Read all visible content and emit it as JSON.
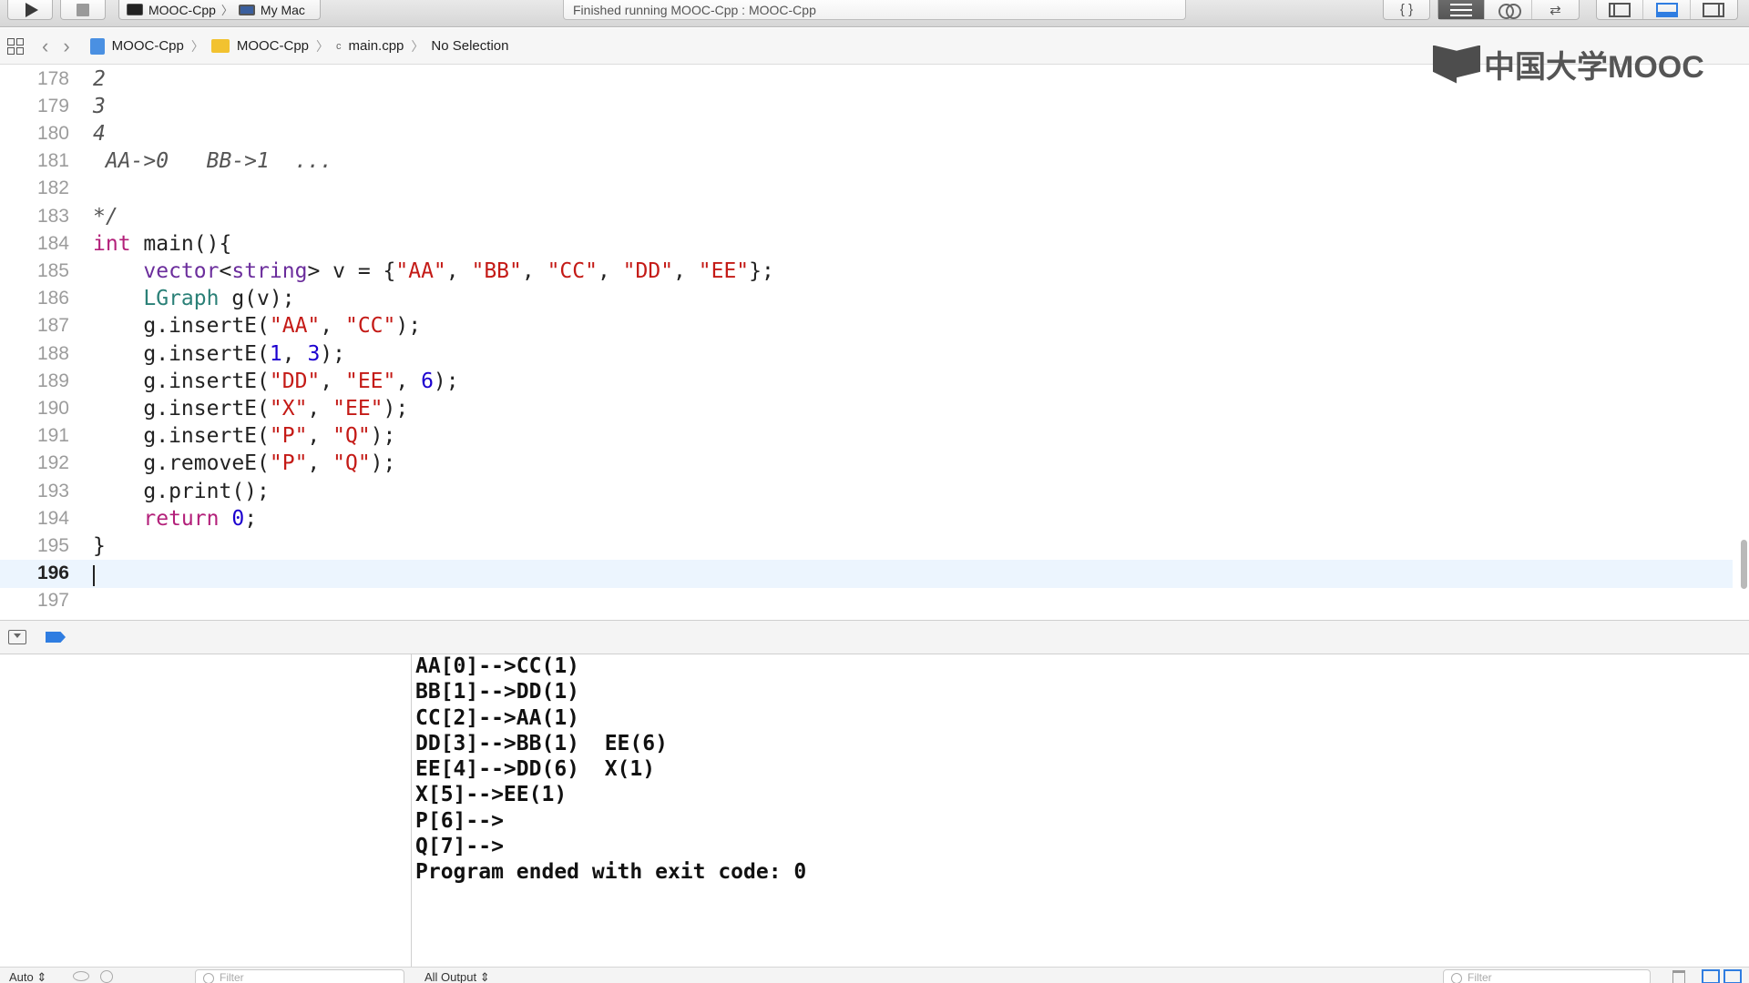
{
  "toolbar": {
    "scheme_name": "MOOC-Cpp",
    "destination": "My Mac",
    "activity_status": "Finished running MOOC-Cpp : MOOC-Cpp",
    "braces_label": "{ }",
    "swap_label": "⇄"
  },
  "jumpbar": {
    "project": "MOOC-Cpp",
    "folder": "MOOC-Cpp",
    "file_icon_text": "c",
    "file": "main.cpp",
    "selection": "No Selection"
  },
  "watermark": {
    "text": "中国大学MOOC"
  },
  "editor": {
    "lines": [
      {
        "num": "178",
        "tokens": [
          {
            "t": "2",
            "c": "comment"
          }
        ]
      },
      {
        "num": "179",
        "tokens": [
          {
            "t": "3",
            "c": "comment"
          }
        ]
      },
      {
        "num": "180",
        "tokens": [
          {
            "t": "4",
            "c": "comment"
          }
        ]
      },
      {
        "num": "181",
        "tokens": [
          {
            "t": " AA->0   BB->1  ...",
            "c": "comment"
          }
        ]
      },
      {
        "num": "182",
        "tokens": []
      },
      {
        "num": "183",
        "tokens": [
          {
            "t": "*/",
            "c": "comment"
          }
        ]
      },
      {
        "num": "184",
        "tokens": [
          {
            "t": "int",
            "c": "kw"
          },
          {
            "t": " main(){",
            "c": ""
          }
        ]
      },
      {
        "num": "185",
        "tokens": [
          {
            "t": "    ",
            "c": ""
          },
          {
            "t": "vector",
            "c": "ty"
          },
          {
            "t": "<",
            "c": ""
          },
          {
            "t": "string",
            "c": "ty"
          },
          {
            "t": "> v = {",
            "c": ""
          },
          {
            "t": "\"AA\"",
            "c": "str"
          },
          {
            "t": ", ",
            "c": ""
          },
          {
            "t": "\"BB\"",
            "c": "str"
          },
          {
            "t": ", ",
            "c": ""
          },
          {
            "t": "\"CC\"",
            "c": "str"
          },
          {
            "t": ", ",
            "c": ""
          },
          {
            "t": "\"DD\"",
            "c": "str"
          },
          {
            "t": ", ",
            "c": ""
          },
          {
            "t": "\"EE\"",
            "c": "str"
          },
          {
            "t": "};",
            "c": ""
          }
        ]
      },
      {
        "num": "186",
        "tokens": [
          {
            "t": "    ",
            "c": ""
          },
          {
            "t": "LGraph",
            "c": "cls"
          },
          {
            "t": " g(v);",
            "c": ""
          }
        ]
      },
      {
        "num": "187",
        "tokens": [
          {
            "t": "    g.insertE(",
            "c": ""
          },
          {
            "t": "\"AA\"",
            "c": "str"
          },
          {
            "t": ", ",
            "c": ""
          },
          {
            "t": "\"CC\"",
            "c": "str"
          },
          {
            "t": ");",
            "c": ""
          }
        ]
      },
      {
        "num": "188",
        "tokens": [
          {
            "t": "    g.insertE(",
            "c": ""
          },
          {
            "t": "1",
            "c": "num"
          },
          {
            "t": ", ",
            "c": ""
          },
          {
            "t": "3",
            "c": "num"
          },
          {
            "t": ");",
            "c": ""
          }
        ]
      },
      {
        "num": "189",
        "tokens": [
          {
            "t": "    g.insertE(",
            "c": ""
          },
          {
            "t": "\"DD\"",
            "c": "str"
          },
          {
            "t": ", ",
            "c": ""
          },
          {
            "t": "\"EE\"",
            "c": "str"
          },
          {
            "t": ", ",
            "c": ""
          },
          {
            "t": "6",
            "c": "num"
          },
          {
            "t": ");",
            "c": ""
          }
        ]
      },
      {
        "num": "190",
        "tokens": [
          {
            "t": "    g.insertE(",
            "c": ""
          },
          {
            "t": "\"X\"",
            "c": "str"
          },
          {
            "t": ", ",
            "c": ""
          },
          {
            "t": "\"EE\"",
            "c": "str"
          },
          {
            "t": ");",
            "c": ""
          }
        ]
      },
      {
        "num": "191",
        "tokens": [
          {
            "t": "    g.insertE(",
            "c": ""
          },
          {
            "t": "\"P\"",
            "c": "str"
          },
          {
            "t": ", ",
            "c": ""
          },
          {
            "t": "\"Q\"",
            "c": "str"
          },
          {
            "t": ");",
            "c": ""
          }
        ]
      },
      {
        "num": "192",
        "tokens": [
          {
            "t": "    g.removeE(",
            "c": ""
          },
          {
            "t": "\"P\"",
            "c": "str"
          },
          {
            "t": ", ",
            "c": ""
          },
          {
            "t": "\"Q\"",
            "c": "str"
          },
          {
            "t": ");",
            "c": ""
          }
        ]
      },
      {
        "num": "193",
        "tokens": [
          {
            "t": "    g.print();",
            "c": ""
          }
        ]
      },
      {
        "num": "194",
        "tokens": [
          {
            "t": "    ",
            "c": ""
          },
          {
            "t": "return",
            "c": "kw"
          },
          {
            "t": " ",
            "c": ""
          },
          {
            "t": "0",
            "c": "num"
          },
          {
            "t": ";",
            "c": ""
          }
        ]
      },
      {
        "num": "195",
        "tokens": [
          {
            "t": "}",
            "c": ""
          }
        ]
      },
      {
        "num": "196",
        "tokens": [],
        "current": true
      },
      {
        "num": "197",
        "tokens": []
      }
    ]
  },
  "console": {
    "output": [
      "AA[0]-->CC(1)",
      "BB[1]-->DD(1)",
      "CC[2]-->AA(1)",
      "DD[3]-->BB(1)  EE(6)",
      "EE[4]-->DD(6)  X(1)",
      "X[5]-->EE(1)",
      "P[6]-->",
      "Q[7]-->",
      "Program ended with exit code: 0"
    ]
  },
  "bottom": {
    "variables_mode": "Auto ⇕",
    "filter_placeholder": "Filter",
    "output_mode": "All Output ⇕"
  },
  "colors": {
    "keyword": "#b3207a",
    "type": "#6b2d9c",
    "class": "#2a8077",
    "string": "#c41a16",
    "number": "#1c00cf",
    "current_line": "#ecf5fe",
    "accent": "#2f7de1"
  }
}
